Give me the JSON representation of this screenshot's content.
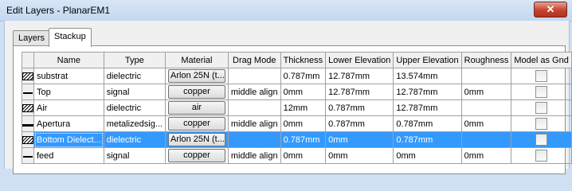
{
  "window": {
    "title": "Edit Layers - PlanarEM1",
    "close_glyph": "✕"
  },
  "tabs": [
    {
      "label": "Layers"
    },
    {
      "label": "Stackup"
    }
  ],
  "columns": [
    "Name",
    "Type",
    "Material",
    "Drag Mode",
    "Thickness",
    "Lower Elevation",
    "Upper Elevation",
    "Roughness",
    "Model as Gnd"
  ],
  "rows": [
    {
      "icon": "hatched-dielectric-icon",
      "name": "substrat",
      "type": "dielectric",
      "material": "Arlon 25N (t...",
      "drag_mode": "",
      "thickness": "0.787mm",
      "lower_elevation": "12.787mm",
      "upper_elevation": "13.574mm",
      "roughness": ""
    },
    {
      "icon": "signal-line-icon",
      "name": "Top",
      "type": "signal",
      "material": "copper",
      "drag_mode": "middle align",
      "thickness": "0mm",
      "lower_elevation": "12.787mm",
      "upper_elevation": "12.787mm",
      "roughness": "0mm"
    },
    {
      "icon": "hatched-dielectric-icon",
      "name": "Air",
      "type": "dielectric",
      "material": "air",
      "drag_mode": "",
      "thickness": "12mm",
      "lower_elevation": "0.787mm",
      "upper_elevation": "12.787mm",
      "roughness": ""
    },
    {
      "icon": "metalized-line-icon",
      "name": "Apertura",
      "type": "metalizedsig...",
      "material": "copper",
      "drag_mode": "middle align",
      "thickness": "0mm",
      "lower_elevation": "0.787mm",
      "upper_elevation": "0.787mm",
      "roughness": "0mm"
    },
    {
      "icon": "hatched-dielectric-icon",
      "name": "Bottom Dielect...",
      "type": "dielectric",
      "material": "Arlon 25N (t...",
      "drag_mode": "",
      "thickness": "0.787mm",
      "lower_elevation": "0mm",
      "upper_elevation": "0.787mm",
      "roughness": "",
      "selected": true
    },
    {
      "icon": "signal-line-icon",
      "name": "feed",
      "type": "signal",
      "material": "copper",
      "drag_mode": "middle align",
      "thickness": "0mm",
      "lower_elevation": "0mm",
      "upper_elevation": "0mm",
      "roughness": "0mm"
    }
  ]
}
